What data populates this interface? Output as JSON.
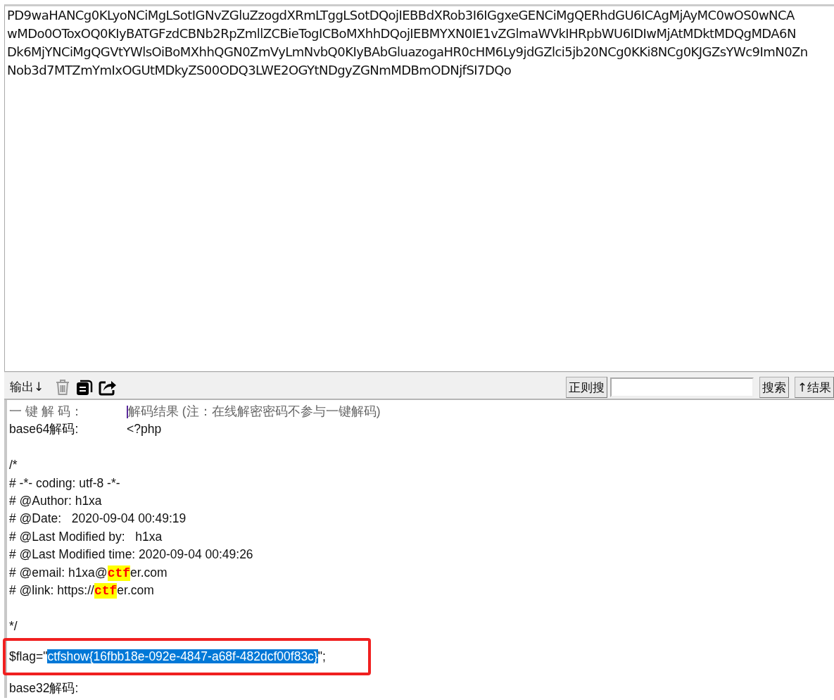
{
  "input": {
    "lines": [
      "PD9waHANCg0KLyoNCiMgLSotIGNvZGluZzogdXRmLTggLSotDQojIEBBdXRob3I6IGgxeGENCiMgQERhdGU6ICAgMjAyMC0wOS0wNCA",
      "wMDo0OToxOQ0KIyBATGFzdCBNb2RpZmllZCBieTogICBoMXhhDQojIEBMYXN0IE1vZGlmaWVkIHRpbWU6IDIwMjAtMDktMDQgMDA6N",
      "Dk6MjYNCiMgQGVtYWlsOiBoMXhhQGN0ZmVyLmNvbQ0KIyBAbGluazogaHR0cHM6Ly9jdGZlci5jb20NCg0KKi8NCg0KJGZsYWc9ImN0Zn",
      "Nob3d7MTZmYmIxOGUtMDkyZS00ODQ3LWE2OGYtNDgyZGNmMDBmODNjfSI7DQo"
    ]
  },
  "toolbar": {
    "output_label": "输出↓",
    "regex_button": "正则搜",
    "search_button": "搜索",
    "result_button": "↑结果"
  },
  "output": [
    {
      "kind": "header",
      "label": "一 键 解 码：",
      "value": "解码结果 (注：在线解密密码不参与一键解码)"
    },
    {
      "kind": "row",
      "label": "base64解码:",
      "value": "<?php"
    },
    {
      "kind": "blank"
    },
    {
      "kind": "code",
      "segments": [
        {
          "text": "/*",
          "highlighted": false
        }
      ]
    },
    {
      "kind": "code",
      "segments": [
        {
          "text": "# -*- coding: utf-8 -*-",
          "highlighted": false
        }
      ]
    },
    {
      "kind": "code",
      "segments": [
        {
          "text": "# @Author: h1xa",
          "highlighted": false
        }
      ]
    },
    {
      "kind": "code",
      "segments": [
        {
          "text": "# @Date:   2020-09-04 00:49:19",
          "highlighted": false
        }
      ]
    },
    {
      "kind": "code",
      "segments": [
        {
          "text": "# @Last Modified by:   h1xa",
          "highlighted": false
        }
      ]
    },
    {
      "kind": "code",
      "segments": [
        {
          "text": "# @Last Modified time: 2020-09-04 00:49:26",
          "highlighted": false
        }
      ]
    },
    {
      "kind": "code",
      "segments": [
        {
          "text": "# @email: h1xa@",
          "highlighted": false
        },
        {
          "text": "ctf",
          "highlighted": true
        },
        {
          "text": "er.com",
          "highlighted": false
        }
      ]
    },
    {
      "kind": "code",
      "segments": [
        {
          "text": "# @link: https://",
          "highlighted": false
        },
        {
          "text": "ctf",
          "highlighted": true
        },
        {
          "text": "er.com",
          "highlighted": false
        }
      ]
    },
    {
      "kind": "blank"
    },
    {
      "kind": "code",
      "segments": [
        {
          "text": "*/",
          "highlighted": false
        }
      ]
    },
    {
      "kind": "flag",
      "segments": [
        {
          "text": "$flag=\"",
          "selected": false
        },
        {
          "text": "ctfshow{16fbb18e-092e-4847-a68f-482dcf00f83c}",
          "selected": true
        },
        {
          "text": "\";",
          "selected": false
        }
      ]
    },
    {
      "kind": "row",
      "label": "base32解码:"
    }
  ]
}
